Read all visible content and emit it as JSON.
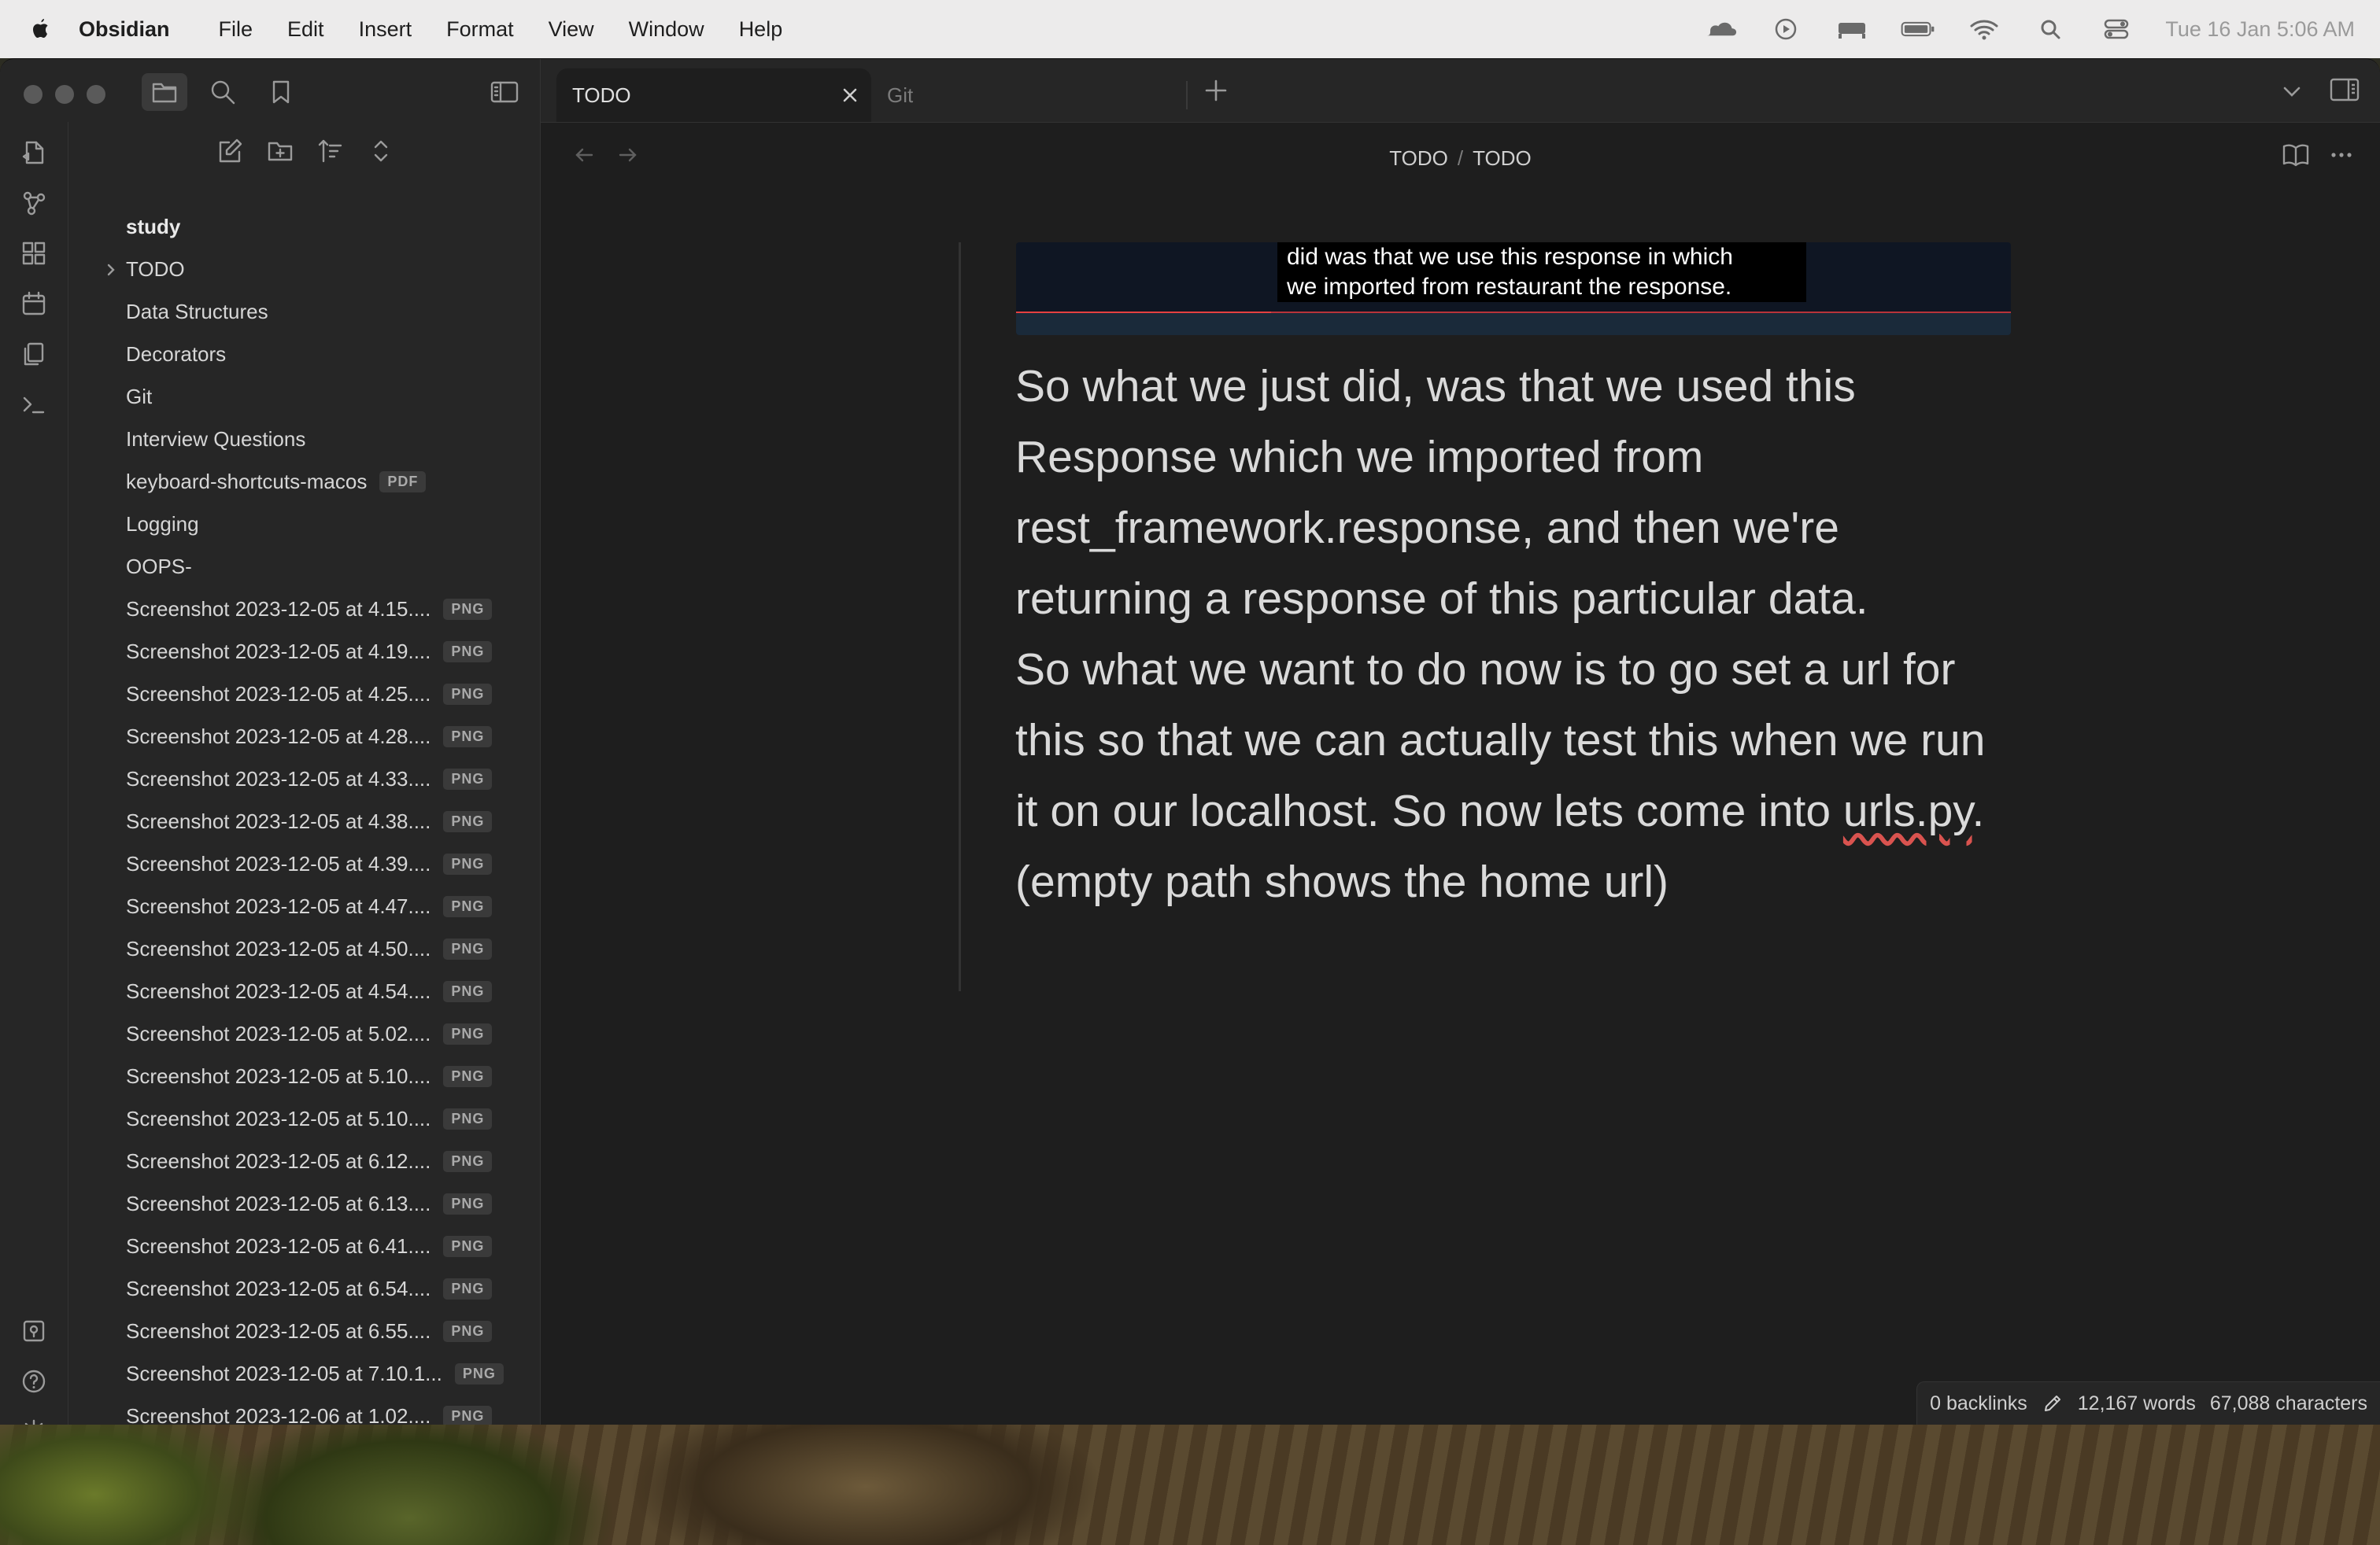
{
  "menubar": {
    "app_name": "Obsidian",
    "menus": [
      "File",
      "Edit",
      "Insert",
      "Format",
      "View",
      "Window",
      "Help"
    ],
    "clock": "Tue 16 Jan  5:06 AM"
  },
  "tabs": {
    "active": "TODO",
    "inactive": "Git"
  },
  "breadcrumb": {
    "parent": "TODO",
    "separator": "/",
    "current": "TODO"
  },
  "sidebar": {
    "root": "study",
    "items": [
      {
        "label": "TODO",
        "badge": "",
        "folder": true
      },
      {
        "label": "Data Structures",
        "badge": ""
      },
      {
        "label": "Decorators",
        "badge": ""
      },
      {
        "label": "Git",
        "badge": ""
      },
      {
        "label": "Interview Questions",
        "badge": ""
      },
      {
        "label": "keyboard-shortcuts-macos",
        "badge": "PDF"
      },
      {
        "label": "Logging",
        "badge": ""
      },
      {
        "label": "OOPS-",
        "badge": ""
      },
      {
        "label": "Screenshot 2023-12-05 at 4.15....",
        "badge": "PNG"
      },
      {
        "label": "Screenshot 2023-12-05 at 4.19....",
        "badge": "PNG"
      },
      {
        "label": "Screenshot 2023-12-05 at 4.25....",
        "badge": "PNG"
      },
      {
        "label": "Screenshot 2023-12-05 at 4.28....",
        "badge": "PNG"
      },
      {
        "label": "Screenshot 2023-12-05 at 4.33....",
        "badge": "PNG"
      },
      {
        "label": "Screenshot 2023-12-05 at 4.38....",
        "badge": "PNG"
      },
      {
        "label": "Screenshot 2023-12-05 at 4.39....",
        "badge": "PNG"
      },
      {
        "label": "Screenshot 2023-12-05 at 4.47....",
        "badge": "PNG"
      },
      {
        "label": "Screenshot 2023-12-05 at 4.50....",
        "badge": "PNG"
      },
      {
        "label": "Screenshot 2023-12-05 at 4.54....",
        "badge": "PNG"
      },
      {
        "label": "Screenshot 2023-12-05 at 5.02....",
        "badge": "PNG"
      },
      {
        "label": "Screenshot 2023-12-05 at 5.10....",
        "badge": "PNG"
      },
      {
        "label": "Screenshot 2023-12-05 at 5.10....",
        "badge": "PNG"
      },
      {
        "label": "Screenshot 2023-12-05 at 6.12....",
        "badge": "PNG"
      },
      {
        "label": "Screenshot 2023-12-05 at 6.13....",
        "badge": "PNG"
      },
      {
        "label": "Screenshot 2023-12-05 at 6.41....",
        "badge": "PNG"
      },
      {
        "label": "Screenshot 2023-12-05 at 6.54....",
        "badge": "PNG"
      },
      {
        "label": "Screenshot 2023-12-05 at 6.55....",
        "badge": "PNG"
      },
      {
        "label": "Screenshot 2023-12-05 at 7.10.1...",
        "badge": "PNG"
      },
      {
        "label": "Screenshot 2023-12-06 at 1.02....",
        "badge": "PNG"
      }
    ]
  },
  "embed": {
    "subtitle_line1": "did was that we use this response in which",
    "subtitle_line2": "we imported from restaurant the response."
  },
  "note": {
    "lines": [
      "So what we just did, was that we used this",
      "Response which we imported from",
      "rest_framework.response, and then we're",
      "returning a response of this particular data.",
      "So what we want to do now is to go set a url for",
      "this so that we can actually test this when we run",
      "it on our localhost. So now lets come into ",
      "(empty path shows the home url)"
    ],
    "misspelled": "urls.py",
    "after_misspelled": "."
  },
  "status": {
    "backlinks": "0 backlinks",
    "words": "12,167 words",
    "characters": "67,088 characters"
  }
}
